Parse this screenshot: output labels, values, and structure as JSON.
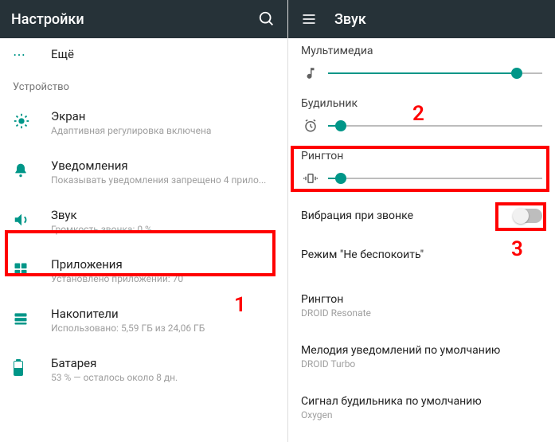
{
  "left": {
    "appbar": {
      "title": "Настройки"
    },
    "more": "Ещё",
    "device_header": "Устройство",
    "items": {
      "screen": {
        "title": "Экран",
        "sub": "Адаптивная регулировка включена"
      },
      "notifications": {
        "title": "Уведомления",
        "sub": "Показывать уведомления запрещено 4 прило..."
      },
      "sound": {
        "title": "Звук",
        "sub": "Громкость звонка: 0 %"
      },
      "apps": {
        "title": "Приложения",
        "sub": "Установлено приложений: 70"
      },
      "storage": {
        "title": "Накопители",
        "sub": "Использовано: 5,59 ГБ из 24,06 ГБ"
      },
      "battery": {
        "title": "Батарея",
        "sub": "53 % — осталось около 8 дн."
      }
    }
  },
  "right": {
    "appbar": {
      "title": "Звук"
    },
    "sliders": {
      "media": {
        "label": "Мультимедиа",
        "pct": 88
      },
      "alarm": {
        "label": "Будильник",
        "pct": 6
      },
      "ringtone": {
        "label": "Рингтон",
        "pct": 6
      }
    },
    "settings": {
      "vibrate": {
        "label": "Вибрация при звонке"
      },
      "dnd": {
        "label": "Режим \"Не беспокоить\""
      },
      "ringtone_pick": {
        "label": "Рингтон",
        "value": "DROID Resonate"
      },
      "notif_sound": {
        "label": "Мелодия уведомлений по умолчанию",
        "value": "DROID Turbo"
      },
      "alarm_sound": {
        "label": "Сигнал будильника по умолчанию",
        "value": "Oxygen"
      }
    }
  },
  "annotations": {
    "n1": "1",
    "n2": "2",
    "n3": "3"
  }
}
